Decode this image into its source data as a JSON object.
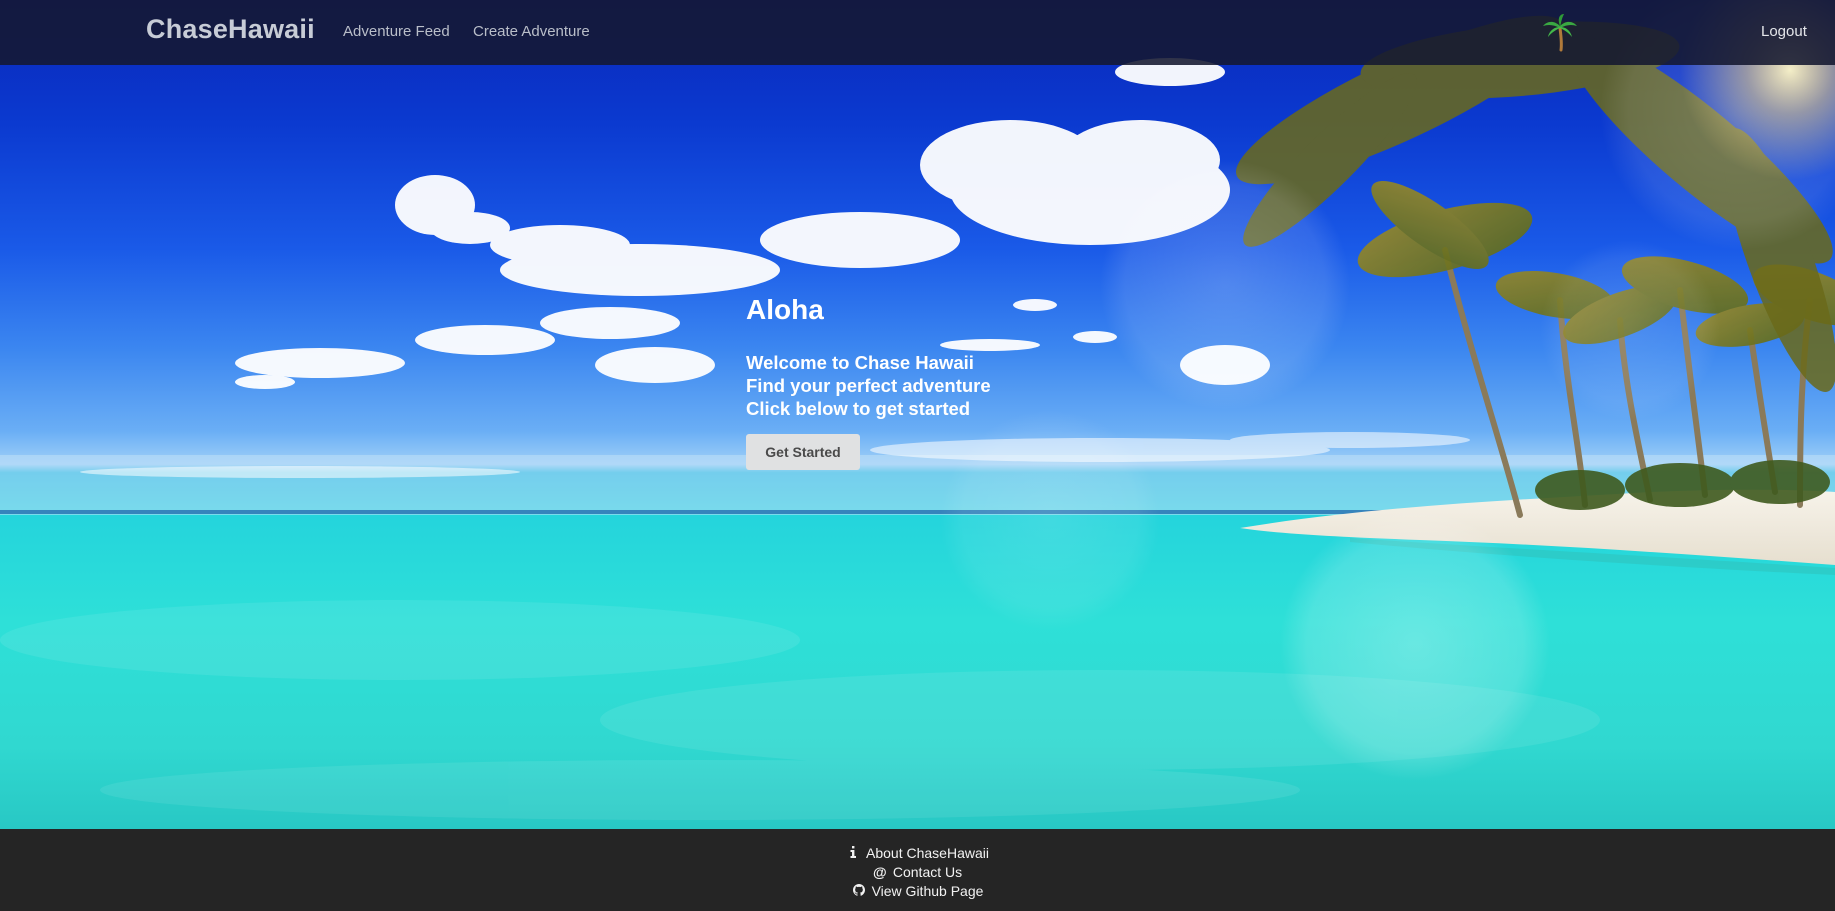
{
  "navbar": {
    "brand": "ChaseHawaii",
    "links": [
      {
        "label": "Adventure Feed"
      },
      {
        "label": "Create Adventure"
      }
    ],
    "logo_icon": "palm-tree-icon",
    "logout_label": "Logout"
  },
  "hero": {
    "title": "Aloha",
    "lines": [
      "Welcome to Chase Hawaii",
      "Find your perfect adventure",
      "Click below to get started"
    ],
    "button_label": "Get Started"
  },
  "footer": {
    "items": [
      {
        "icon": "info-icon",
        "label": "About ChaseHawaii"
      },
      {
        "icon": "at-icon",
        "label": "Contact Us"
      },
      {
        "icon": "github-icon",
        "label": "View Github Page"
      }
    ]
  },
  "colors": {
    "navbar_bg": "#141830",
    "footer_bg": "#252525",
    "button_bg": "#e0e1e2",
    "sky_top": "#0a26b8",
    "ocean": "#2ee0d8"
  }
}
